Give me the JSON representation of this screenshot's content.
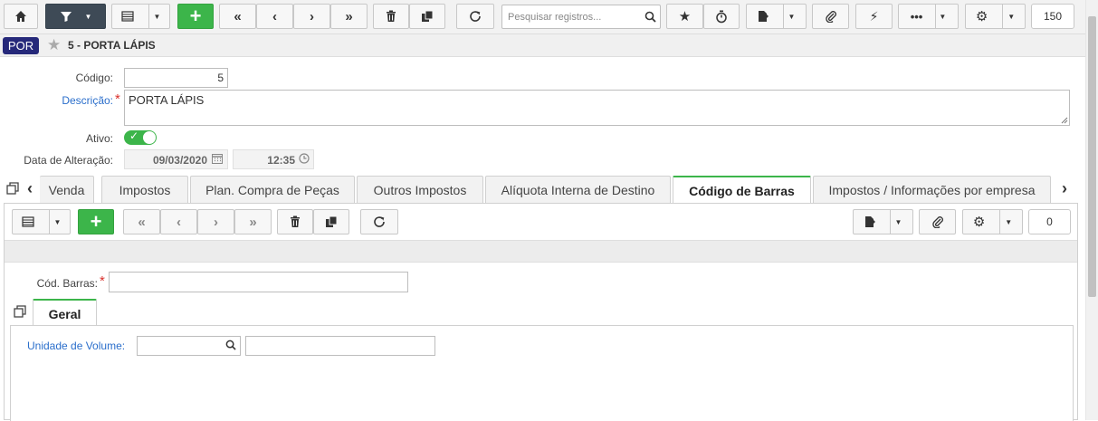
{
  "toolbar": {
    "search_placeholder": "Pesquisar registros...",
    "record_count": "150"
  },
  "header": {
    "badge": "POR",
    "title": "5 - PORTA LÁPIS"
  },
  "form": {
    "codigo_label": "Código:",
    "codigo_value": "5",
    "descricao_label": "Descrição:",
    "descricao_value": "PORTA LÁPIS",
    "ativo_label": "Ativo:",
    "data_alteracao_label": "Data de Alteração:",
    "data_value": "09/03/2020",
    "hora_value": "12:35"
  },
  "tabs": [
    {
      "label": "Venda"
    },
    {
      "label": "Impostos"
    },
    {
      "label": "Plan. Compra de Peças"
    },
    {
      "label": "Outros Impostos"
    },
    {
      "label": "Alíquota Interna de Destino"
    },
    {
      "label": "Código de Barras"
    },
    {
      "label": "Impostos / Informações por empresa"
    }
  ],
  "subtoolbar": {
    "record_count": "0"
  },
  "barcode_form": {
    "cod_barras_label": "Cód. Barras:",
    "cod_barras_value": "",
    "subtab_label": "Geral",
    "unidade_label": "Unidade de Volume:",
    "unidade_code": "",
    "unidade_desc": ""
  },
  "colors": {
    "accent_green": "#3cb54a",
    "dark_button": "#3e4a56",
    "badge_blue": "#26297a",
    "label_blue": "#2a6ecb",
    "required_red": "#d9302c"
  }
}
